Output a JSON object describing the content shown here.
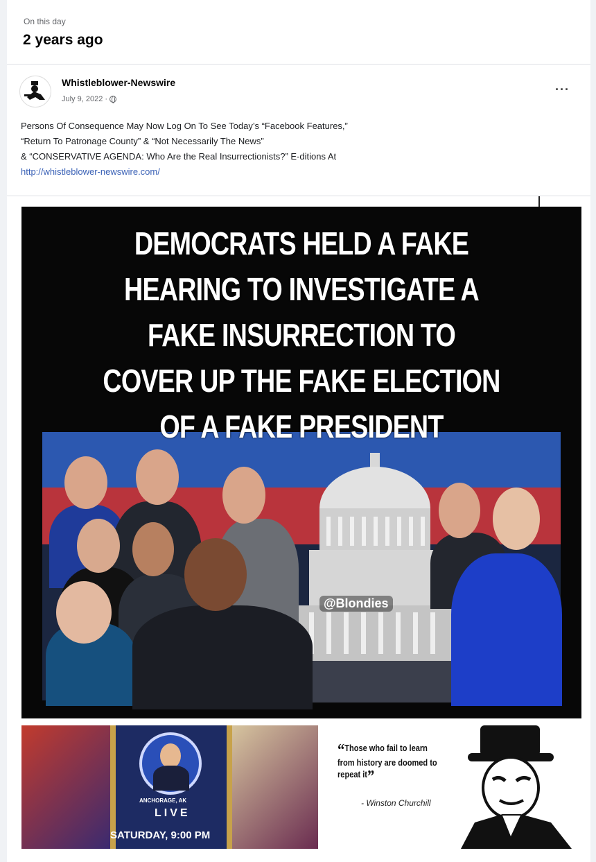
{
  "memory": {
    "label": "On this day",
    "title": "2 years ago"
  },
  "post": {
    "author": "Whistleblower-Newswire",
    "date": "July 9, 2022 ·",
    "more_label": "···",
    "text_lines": [
      "Persons Of Consequence May Now Log On To See Today’s “Facebook Features,”",
      "“Return To Patronage County” & “Not Necessarily The News”",
      "& “CONSERVATIVE AGENDA: Who Are the Real Insurrectionists?” E-ditions At"
    ],
    "link": "http://whistleblower-newswire.com/"
  },
  "main_image": {
    "headline_lines": [
      "DEMOCRATS HELD A FAKE",
      "HEARING TO INVESTIGATE A",
      "FAKE INSURRECTION TO",
      "COVER UP THE FAKE ELECTION",
      "OF A FAKE PRESIDENT"
    ],
    "watermark": "@Blondies"
  },
  "thumb_left": {
    "location": "ANCHORAGE, AK",
    "live": "LIVE",
    "time": "SATURDAY, 9:00 PM"
  },
  "thumb_right": {
    "quote": "Those who fail to learn from history are doomed to repeat it",
    "attribution": "- Winston Churchill"
  },
  "colors": {
    "link": "#3a61b6",
    "secondary_text": "#65676b",
    "flag_blue": "#2c58b0",
    "flag_red": "#b9343c"
  }
}
